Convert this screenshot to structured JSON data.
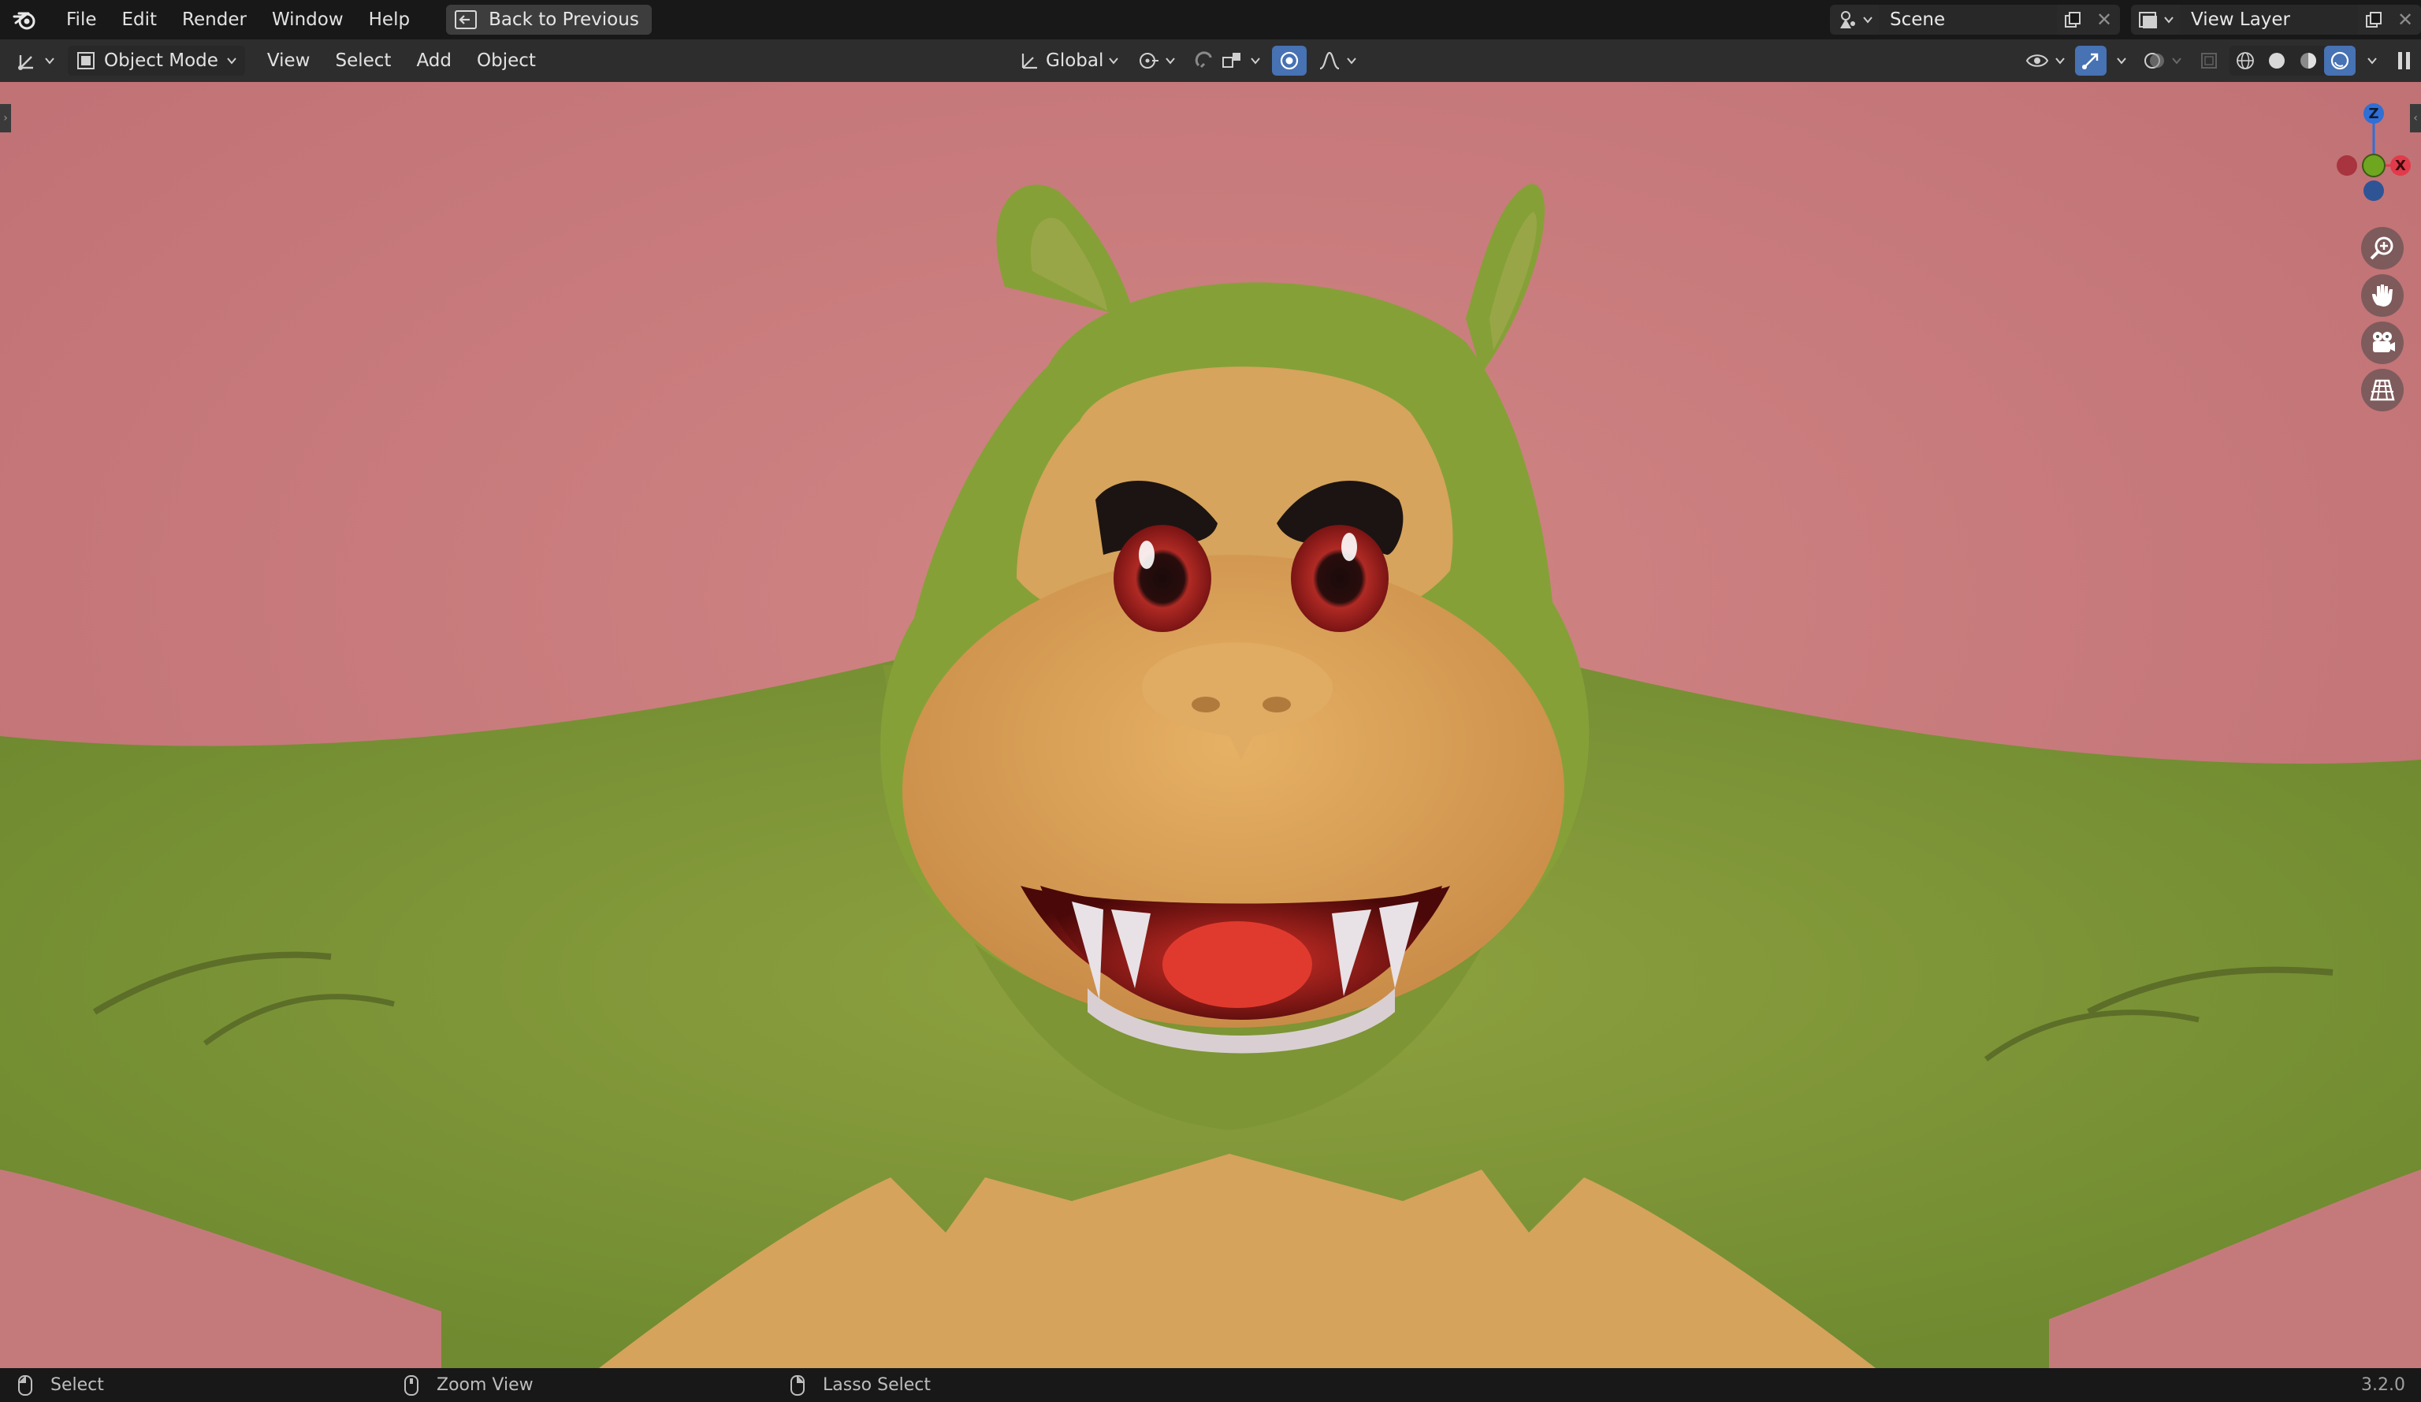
{
  "app": {
    "name": "Blender",
    "version": "3.2.0"
  },
  "topbar": {
    "menus": [
      "File",
      "Edit",
      "Render",
      "Window",
      "Help"
    ],
    "back_button": "Back to Previous",
    "scene": "Scene",
    "view_layer": "View Layer"
  },
  "header": {
    "mode": "Object Mode",
    "menus": [
      "View",
      "Select",
      "Add",
      "Object"
    ],
    "transform_orientation": "Global"
  },
  "viewport": {
    "background_color": "#c9797b",
    "gizmo_axes": [
      "Z",
      "X"
    ]
  },
  "statusbar": {
    "left": "Select",
    "middle": "Zoom View",
    "right": "Lasso Select"
  },
  "colors": {
    "accent": "#4772b3",
    "axis_x": "#e23a4a",
    "axis_y": "#6ea620",
    "axis_z": "#2f6fd6"
  },
  "icons": {
    "logo": "blender-logo-icon",
    "back": "back-arrow-icon",
    "zoom": "zoom-icon",
    "pan": "hand-icon",
    "camera": "camera-icon",
    "ortho": "grid-icon"
  }
}
